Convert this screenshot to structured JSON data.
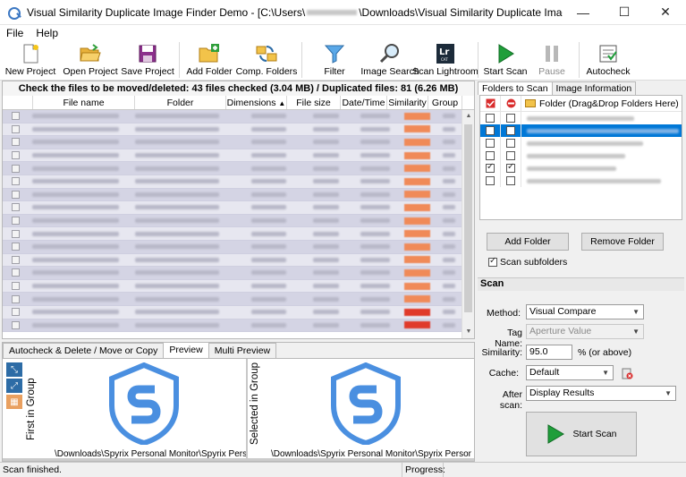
{
  "window": {
    "title": "Visual Similarity Duplicate Image Finder Demo - [C:\\Users\\",
    "title_tail": "\\Downloads\\Visual Similarity Duplicate Image Finder\\Vis...",
    "minimize": "—",
    "maximize": "☐",
    "close": "✕"
  },
  "menu": [
    "File",
    "Help"
  ],
  "toolbar": {
    "new_project": "New Project",
    "open_project": "Open Project",
    "save_project": "Save Project",
    "add_folder": "Add Folder",
    "comp_folders": "Comp. Folders",
    "filter": "Filter",
    "image_search": "Image Search",
    "scan_lightroom": "Scan Lightroom",
    "start_scan": "Start Scan",
    "pause": "Pause",
    "autocheck": "Autocheck"
  },
  "results": {
    "summary": "Check the files to be moved/deleted: 43 files checked (3.04 MB) / Duplicated files: 81 (6.26 MB)",
    "columns": [
      "File name",
      "Folder",
      "Dimensions",
      "File size",
      "Date/Time",
      "Similarity",
      "Group"
    ],
    "row_count": 17
  },
  "preview": {
    "tabs": [
      "Autocheck & Delete / Move or Copy",
      "Preview",
      "Multi Preview"
    ],
    "first_label": "First in Group",
    "selected_label": "Selected in Group",
    "path_left": "\\Downloads\\Spyrix Personal Monitor\\Spyrix Personal M",
    "path_right": "\\Downloads\\Spyrix Personal Monitor\\Spyrix Personal M"
  },
  "folders": {
    "tabs": [
      "Folders to Scan",
      "Image Information"
    ],
    "header_label": "Folder (Drag&Drop Folders Here)",
    "rows": [
      {
        "include": false,
        "exclude": false,
        "selected": false
      },
      {
        "include": false,
        "exclude": false,
        "selected": true
      },
      {
        "include": false,
        "exclude": false,
        "selected": false
      },
      {
        "include": false,
        "exclude": false,
        "selected": false
      },
      {
        "include": true,
        "exclude": true,
        "selected": false
      },
      {
        "include": false,
        "exclude": false,
        "selected": false
      }
    ],
    "add_folder": "Add Folder",
    "remove_folder": "Remove Folder",
    "scan_subfolders": "Scan subfolders"
  },
  "scan": {
    "heading": "Scan",
    "method_label": "Method:",
    "method_value": "Visual Compare",
    "tag_label": "Tag Name:",
    "tag_value": "Aperture Value",
    "similarity_label": "Similarity:",
    "similarity_value": "95.0",
    "similarity_suffix": "% (or above)",
    "cache_label": "Cache:",
    "cache_value": "Default",
    "after_label": "After scan:",
    "after_value": "Display Results",
    "start_button": "Start Scan"
  },
  "status": {
    "left": "Scan finished.",
    "progress_label": "Progress:"
  },
  "colors": {
    "accent_blue": "#0078d7",
    "shield_blue": "#4a8fe0",
    "start_green": "#1f9e3a",
    "row_purple": "#d4d4e4",
    "similarity_orange": "#f08a58"
  }
}
